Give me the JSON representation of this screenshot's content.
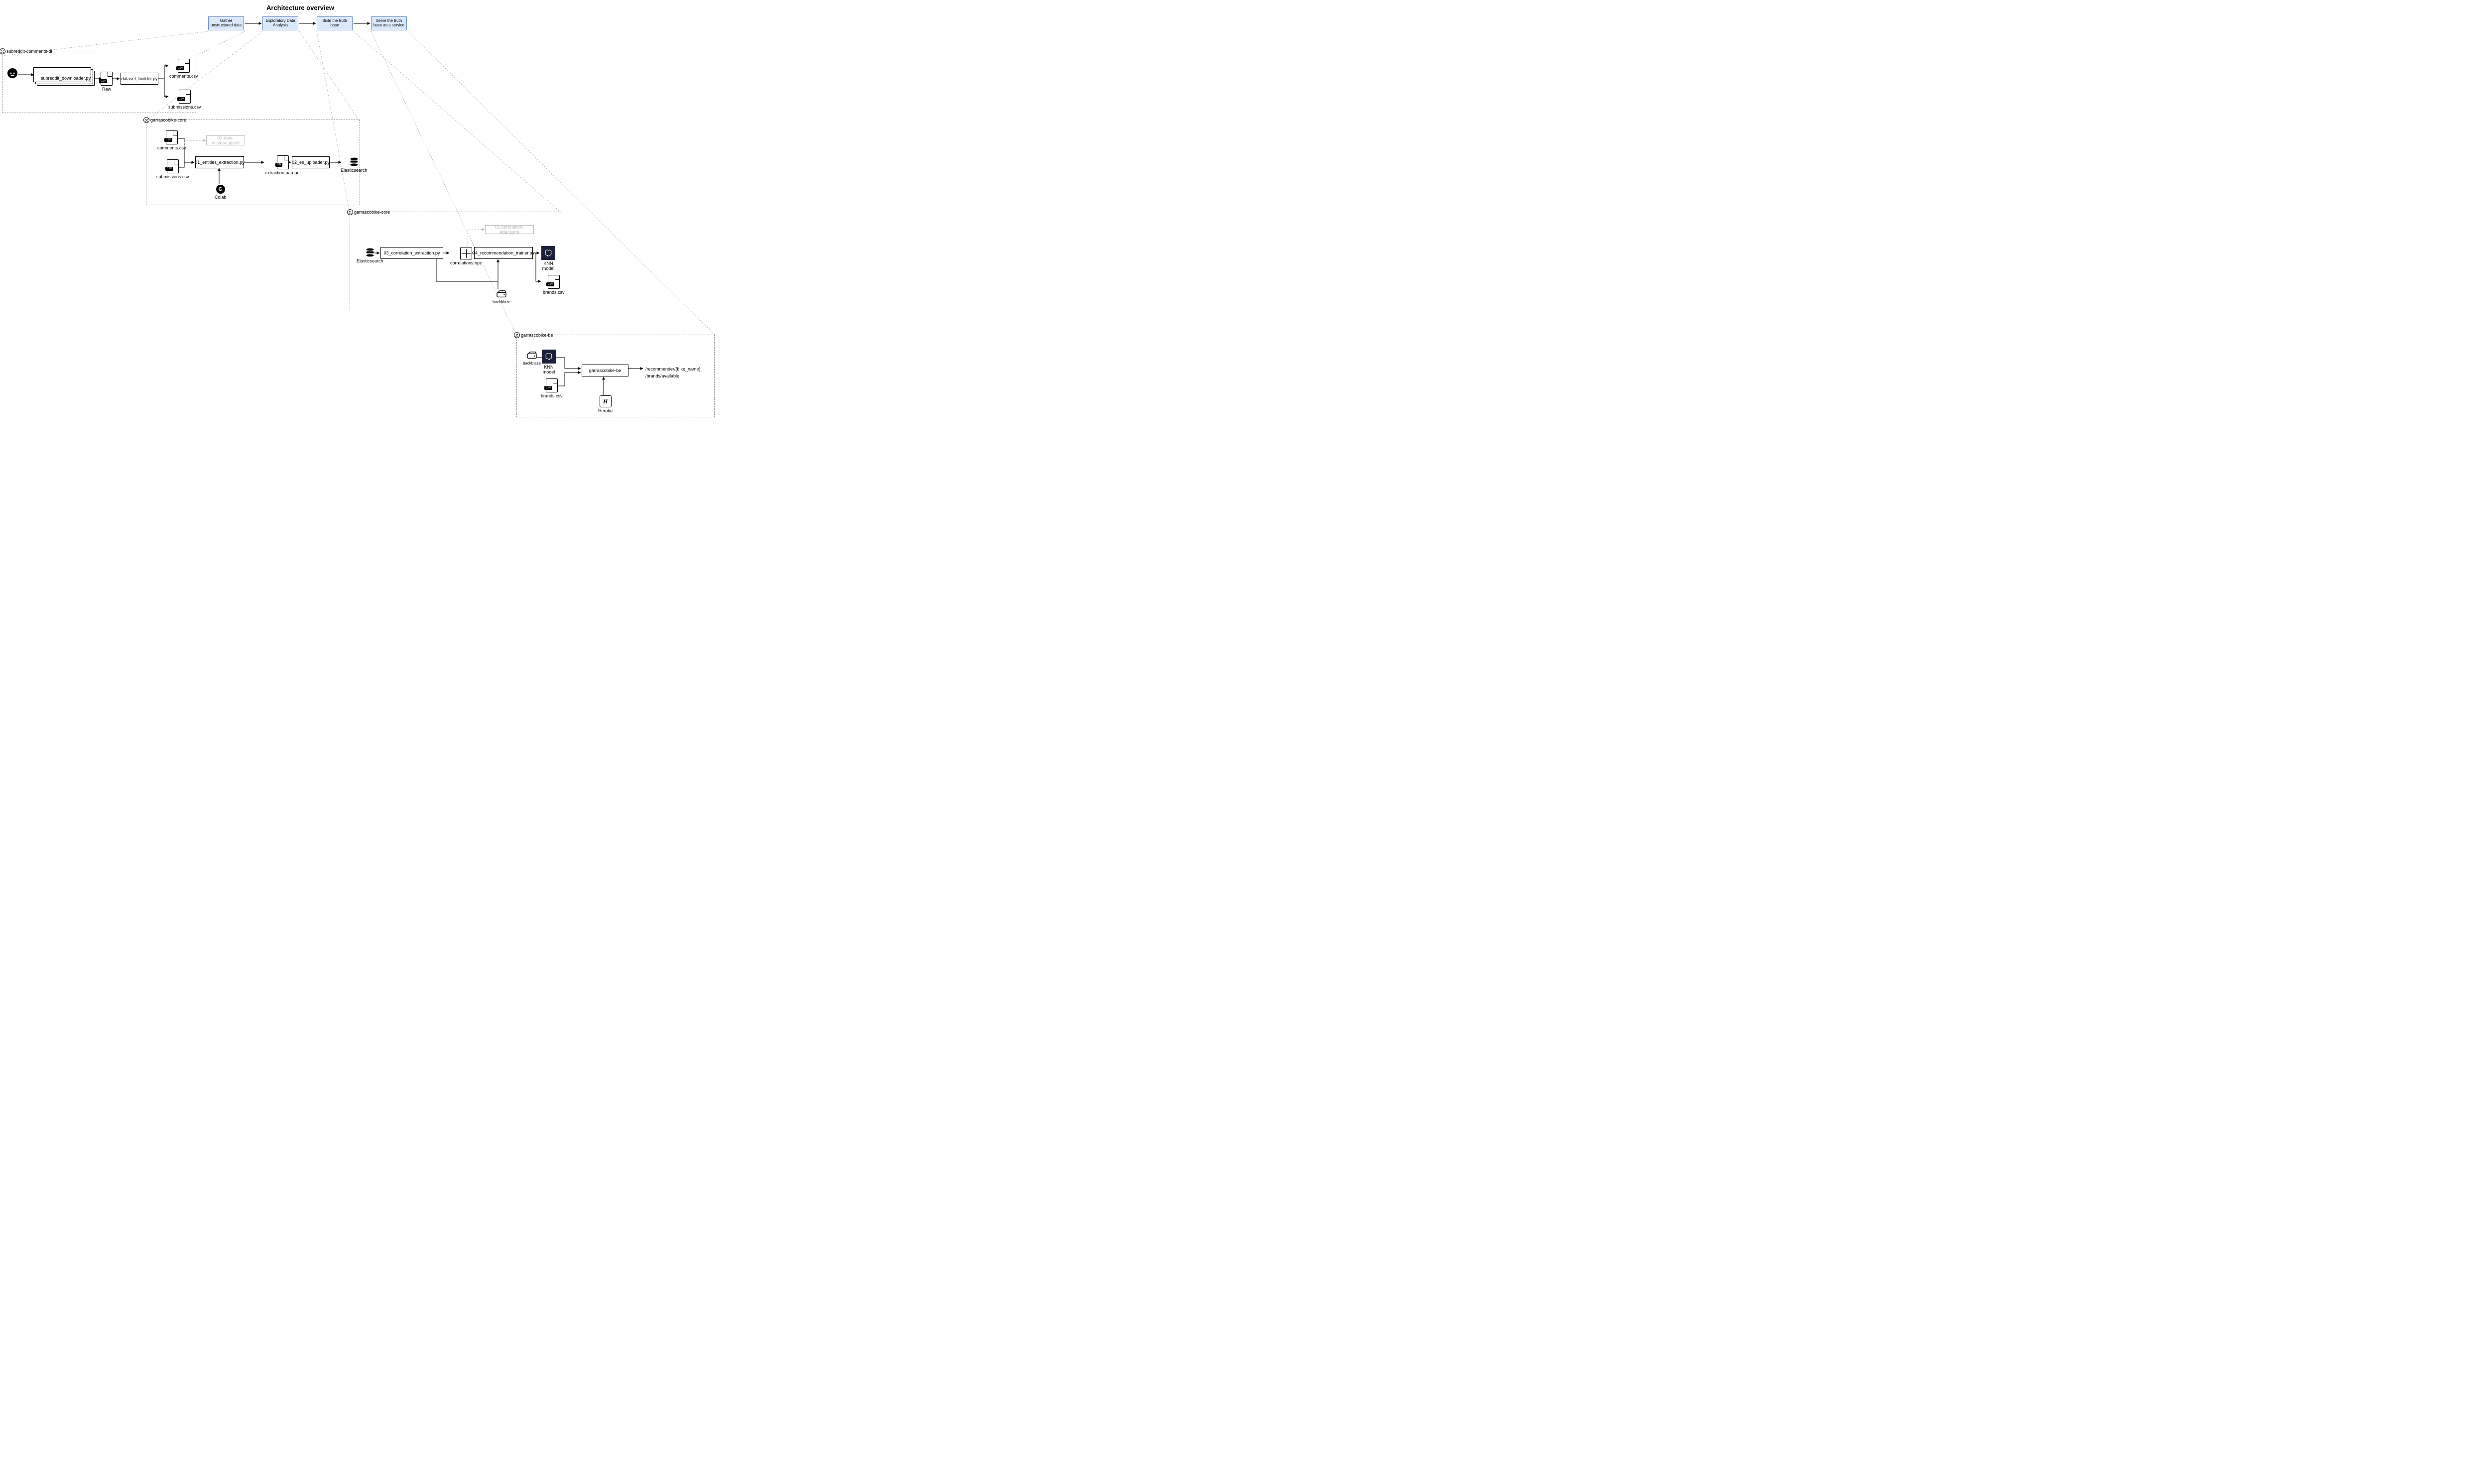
{
  "title": "Architecture overview",
  "stages": [
    {
      "label": "Gather unstructured data"
    },
    {
      "label": "Exploratory Data Analysis"
    },
    {
      "label": "Build the truth base"
    },
    {
      "label": "Serve the truth base as a service"
    }
  ],
  "groups": {
    "g1": {
      "repo": "subreddit-comments-dl"
    },
    "g2": {
      "repo": "garrascobike-core"
    },
    "g3": {
      "repo": "garrascobike-core"
    },
    "g4": {
      "repo": "garrascobike-be"
    }
  },
  "g1": {
    "proc1": "subreddit_downloader.py",
    "rawLabel": "Raw",
    "proc2": "dataset_builder.py",
    "comments": "comments.csv",
    "submissions": "submissions.csv"
  },
  "g2": {
    "comments": "comments.csv",
    "submissions": "submissions.csv",
    "mistreat": "01-data-mistreat.ipynb",
    "entities": "01_entities_extraction.py",
    "extraction": "extraction.parquet",
    "uploader": "02_es_uploader.py",
    "es": "Elasticsearch",
    "colab": "Colab"
  },
  "g3": {
    "es": "Elasticsearch",
    "corrExtract": "03_correlation_extraction.py",
    "corrNpz": "correlations.npz",
    "corrEda": "01-correlation-eda.ipynb",
    "trainer": "04_recommendation_trainer.py",
    "knn": "KNN model",
    "brands": "brands.csv",
    "backblaze": "backblaze"
  },
  "g4": {
    "backblaze": "backblaze",
    "knn": "KNN model",
    "brands": "brands.csv",
    "be": "garrascobike-be",
    "ep1": "/recommender/{bike_name}",
    "ep2": "/brands/available",
    "heroku": "Heroku"
  }
}
